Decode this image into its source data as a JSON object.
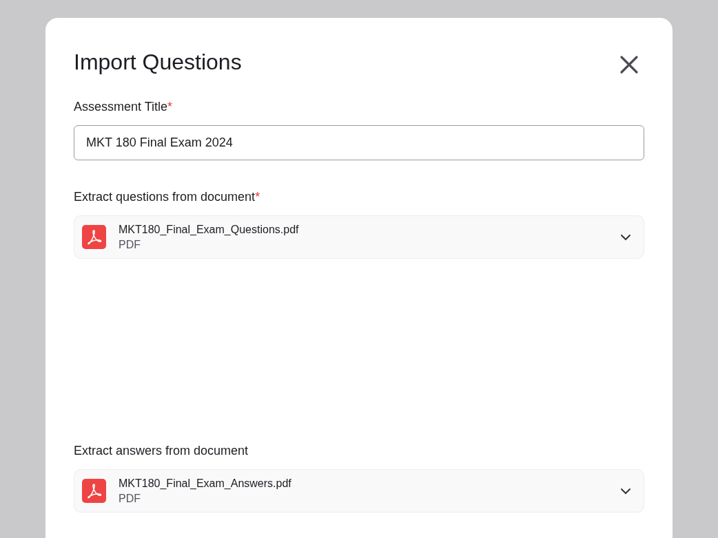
{
  "dialog": {
    "title": "Import Questions"
  },
  "title_field": {
    "label": "Assessment Title",
    "required_mark": "*",
    "value": "MKT 180 Final Exam 2024"
  },
  "documents": [
    {
      "label": "Extract questions from document",
      "required_mark": "*",
      "file_name": "MKT180_Final_Exam_Questions.pdf",
      "file_type": "PDF"
    },
    {
      "label": "Extract answers from document",
      "file_name": "MKT180_Final_Exam_Answers.pdf",
      "file_type": "PDF"
    }
  ]
}
